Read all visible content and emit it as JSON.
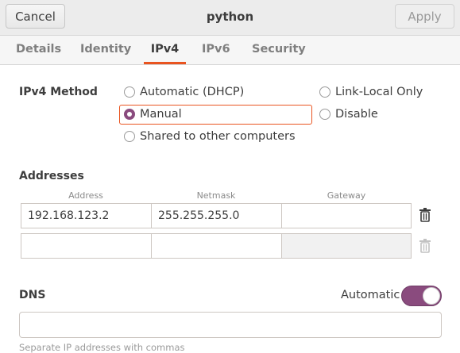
{
  "header": {
    "cancel_label": "Cancel",
    "title": "python",
    "apply_label": "Apply"
  },
  "tabs": [
    {
      "label": "Details"
    },
    {
      "label": "Identity"
    },
    {
      "label": "IPv4",
      "active": true
    },
    {
      "label": "IPv6"
    },
    {
      "label": "Security"
    }
  ],
  "ipv4_method": {
    "label": "IPv4 Method",
    "selected": "Manual",
    "options": [
      {
        "label": "Automatic (DHCP)"
      },
      {
        "label": "Manual"
      },
      {
        "label": "Shared to other computers"
      },
      {
        "label": "Link-Local Only"
      },
      {
        "label": "Disable"
      }
    ]
  },
  "addresses": {
    "label": "Addresses",
    "columns": [
      "Address",
      "Netmask",
      "Gateway"
    ],
    "rows": [
      {
        "address": "192.168.123.2",
        "netmask": "255.255.255.0",
        "gateway": ""
      },
      {
        "address": "",
        "netmask": "",
        "gateway": ""
      }
    ]
  },
  "dns": {
    "label": "DNS",
    "automatic_label": "Automatic",
    "automatic_on": true,
    "value": "",
    "hint": "Separate IP addresses with commas"
  },
  "icons": {
    "trash": "trash-icon"
  },
  "colors": {
    "accent": "#e95420",
    "selected": "#8a4b7e"
  }
}
